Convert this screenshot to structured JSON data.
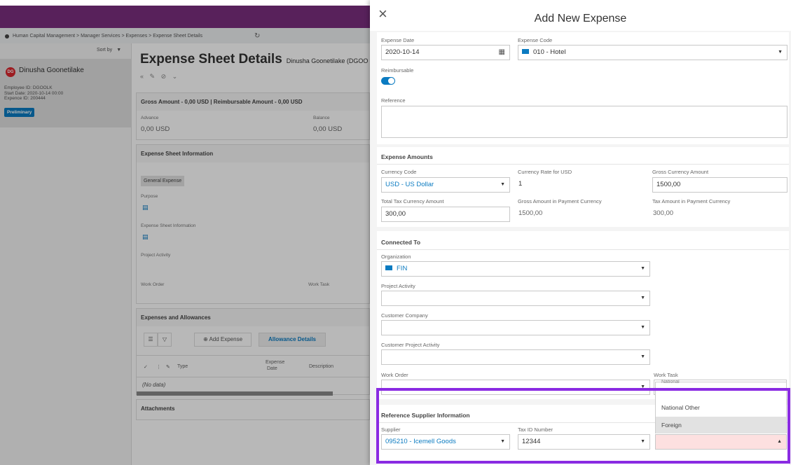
{
  "background": {
    "breadcrumb": "Human Capital Management > Manager Services > Expenses > Expense Sheet Details",
    "sort_by": "Sort by",
    "employee": {
      "initials": "DG",
      "name": "Dinusha Goonetilake",
      "employee_id": "Employee ID:  DGOOLK",
      "start_date": "Start Date:  2020-10-14 00:00",
      "expense_id": "Expence ID:  200444",
      "status": "Preliminary"
    },
    "title": "Expense Sheet Details",
    "title_sub": "Dinusha Goonetilake (DGOO",
    "gross_header": "Gross Amount - 0,00 USD | Reimbursable Amount - 0,00 USD",
    "advance_label": "Advance",
    "advance_value": "0,00 USD",
    "balance_label": "Balance",
    "balance_value": "0,00 USD",
    "info_header": "Expense Sheet Information",
    "chip": "General Expense",
    "purpose_label": "Purpose",
    "info_label": "Expense Sheet Information",
    "project_activity_label": "Project Activity",
    "work_order_label": "Work Order",
    "work_task_label": "Work Task",
    "expenses_header": "Expenses and Allowances",
    "add_expense": "Add Expense",
    "allowance_details": "Allowance Details",
    "col_type": "Type",
    "col_expense_date_1": "Expense",
    "col_expense_date_2": "Date",
    "col_description": "Description",
    "no_data": "(No data)",
    "attachments_header": "Attachments"
  },
  "dialog": {
    "title": "Add New Expense",
    "expense_date_label": "Expense Date",
    "expense_date": "2020-10-14",
    "expense_code_label": "Expense Code",
    "expense_code": "010 - Hotel",
    "reimbursable_label": "Reimbursable",
    "reimbursable": true,
    "reference_label": "Reference",
    "amounts_header": "Expense Amounts",
    "currency_code_label": "Currency Code",
    "currency_code": "USD - US Dollar",
    "currency_rate_label": "Currency Rate for USD",
    "currency_rate": "1",
    "gross_currency_label": "Gross Currency Amount",
    "gross_currency": "1500,00",
    "total_tax_label": "Total Tax Currency Amount",
    "total_tax": "300,00",
    "gross_payment_label": "Gross Amount in Payment Currency",
    "gross_payment": "1500,00",
    "tax_payment_label": "Tax Amount in Payment Currency",
    "tax_payment": "300,00",
    "connected_header": "Connected To",
    "organization_label": "Organization",
    "organization": "FIN",
    "project_activity_label": "Project Activity",
    "customer_company_label": "Customer Company",
    "customer_project_label": "Customer Project Activity",
    "work_order_label": "Work Order",
    "work_task_label": "Work Task",
    "supplier_header": "Reference Supplier Information",
    "supplier_label": "Supplier",
    "supplier": "095210 - Icemell Goods",
    "tax_id_label": "Tax ID Number",
    "tax_id": "12344",
    "dropdown_options": [
      "National",
      "National Other",
      "Foreign"
    ],
    "dropdown_highlighted": "Foreign"
  },
  "colors": {
    "brand": "#7b2f7f",
    "accent": "#0b7bc1",
    "highlight_box": "#8a2be2",
    "invalid_field": "#fde0e0"
  }
}
